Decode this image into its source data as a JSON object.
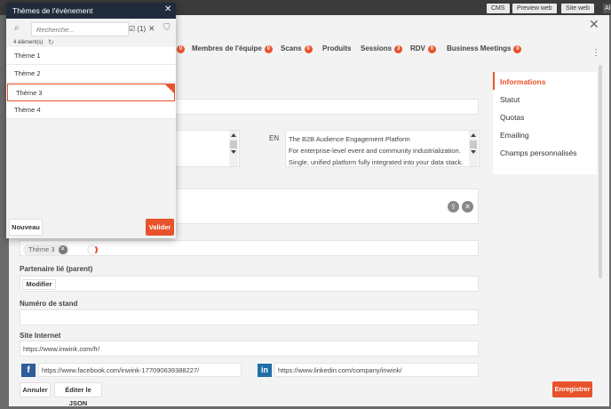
{
  "topbar": {
    "buttons": [
      "CMS",
      "Preview web",
      "Site web"
    ],
    "ai_label": "Al"
  },
  "tabs": [
    {
      "label": "Membres de l'équipe",
      "badge": "0"
    },
    {
      "label": "Scans",
      "badge": "0"
    },
    {
      "label": "Produits",
      "badge": ""
    },
    {
      "label": "Sessions",
      "badge": "3"
    },
    {
      "label": "RDV",
      "badge": "0"
    },
    {
      "label": "Business Meetings",
      "badge": "0"
    }
  ],
  "first_tab_badge": "0",
  "right_nav": {
    "items": [
      "Informations",
      "Statut",
      "Quotas",
      "Emailing",
      "Champs personnalisés"
    ],
    "active_index": 0
  },
  "description": {
    "lang": "EN",
    "lines": [
      "The B2B Audience Engagement Platform",
      "For enterprise-level event and community industrialization.",
      "Single, unified platform fully integrated into your data stack."
    ]
  },
  "themes_chip": {
    "label": "Thème 3"
  },
  "parent": {
    "label": "Partenaire lié (parent)",
    "button": "Modifier"
  },
  "stand": {
    "label": "Numéro de stand",
    "value": ""
  },
  "website": {
    "label": "Site Internet",
    "value": "https://www.inwink.com/fr/"
  },
  "social": {
    "facebook": "https://www.facebook.com/inwink-177090639388227/",
    "linkedin": "https://www.linkedin.com/company/inwink/"
  },
  "footer": {
    "cancel": "Annuler",
    "edit_json": "Éditer le JSON",
    "save": "Enregistrer"
  },
  "popup": {
    "title": "Thèmes de l'évènement",
    "search_placeholder": "Recherche...",
    "selected_count": "(1)",
    "element_count": "4 élément(s)",
    "items": [
      "Thème 1",
      "Thème 2",
      "Thème 3",
      "Thème 4"
    ],
    "selected_index": 2,
    "new_button": "Nouveau",
    "validate_button": "Valider"
  },
  "colors": {
    "accent": "#e8532b",
    "popup_header": "#202b3b",
    "topbar": "#3b3b3b",
    "overlay": "#6b6b6b"
  }
}
